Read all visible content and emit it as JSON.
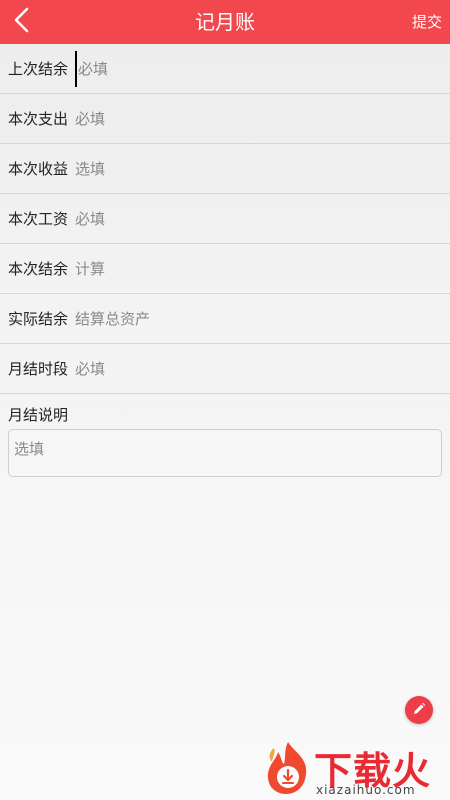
{
  "header": {
    "title": "记月账",
    "submit_label": "提交",
    "back_icon": "back-arrow-icon"
  },
  "form": {
    "rows": [
      {
        "label": "上次结余",
        "placeholder": "必填"
      },
      {
        "label": "本次支出",
        "placeholder": "必填"
      },
      {
        "label": "本次收益",
        "placeholder": "选填"
      },
      {
        "label": "本次工资",
        "placeholder": "必填"
      },
      {
        "label": "本次结余",
        "placeholder": "计算"
      },
      {
        "label": "实际结余",
        "placeholder": "结算总资产"
      },
      {
        "label": "月结时段",
        "placeholder": "必填"
      }
    ],
    "memo": {
      "label": "月结说明",
      "placeholder": "选填"
    }
  },
  "fab": {
    "icon": "pencil-icon"
  },
  "watermark": {
    "text": "下载火",
    "domain": "xiazaihuo.com"
  },
  "colors": {
    "accent": "#f2474c",
    "fab": "#ef3e48",
    "watermark": "#ea2a33"
  }
}
